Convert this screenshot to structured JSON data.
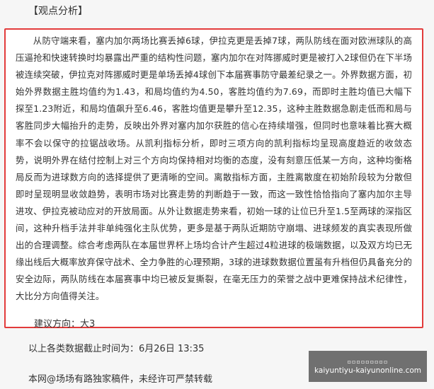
{
  "section_heading": "【观点分析】",
  "analysis_text": "从防守端来看，塞内加尔两场比赛丢掉6球，伊拉克更是丢掉7球，两队防线在面对欧洲球队的高压逼抢和快速转换时均暴露出严重的结构性问题，塞内加尔在对阵挪威时更是被打入2球但仍在下半场被连续突破，伊拉克对阵挪威时更是单场丢掉4球创下本届赛事防守最差纪录之一。外界数据方面，初始外界数据主胜均值约为1.43，和局均值约为4.50，客胜均值约为7.69，而即时主胜均值已大幅下探至1.23附近，和局均值飙升至6.46，客胜均值更是攀升至12.35，这种主胜数据急剧走低而和局与客胜同步大幅抬升的走势，反映出外界对塞内加尔获胜的信心在持续增强，但同时也意味着比赛大概率不会以保守的拉锯战收场。从凯利指标分析，即时三项方向的凯利指标均呈现高度趋近的收敛态势，说明外界在结付控制上对三个方向均保持相对均衡的态度，没有刻意压低某一方向，这种均衡格局反而为进球数方向的选择提供了更清晰的空间。离散指标方面，主胜离散度在初始阶段较为分散但即时呈现明显收敛趋势，表明市场对比赛走势的判断趋于一致，而这一致性恰恰指向了塞内加尔主导进攻、伊拉克被动应对的开放局面。从外让数据走势来看，初始一球的让位已升至1.5至两球的深指区间，这种升档手法并非单纯强化主队优势，更多是基于两队近期防守崩塌、进球频发的真实表现所做出的合理调整。综合考虑两队在本届世界杯上场均合计产生超过4粒进球的极端数据，以及双方均已无缘出线后大概率放弃保守战术、全力争胜的心理预期，3球的进球数数据位置虽有升档但仍具备充分的安全边际，两队防线在本届赛事中均已被反复撕裂，在毫无压力的荣誉之战中更难保持战术纪律性，大比分方向值得关注。",
  "suggestion": "建议方向：大3",
  "timestamp_line": "以上各类数据截止时间为：6月26日 13:35",
  "copyright_line": "本网@场场有路独家稿件，未经许可严禁转载",
  "watermark": {
    "top_text": "▫▫▫▫▫▫▫▫▫",
    "domain": "kaiyuntiyu-kaiyunonline.com"
  },
  "colors": {
    "card_border": "#e23b3b",
    "page_background": "#f6f6f6",
    "card_background": "#ffffff"
  }
}
